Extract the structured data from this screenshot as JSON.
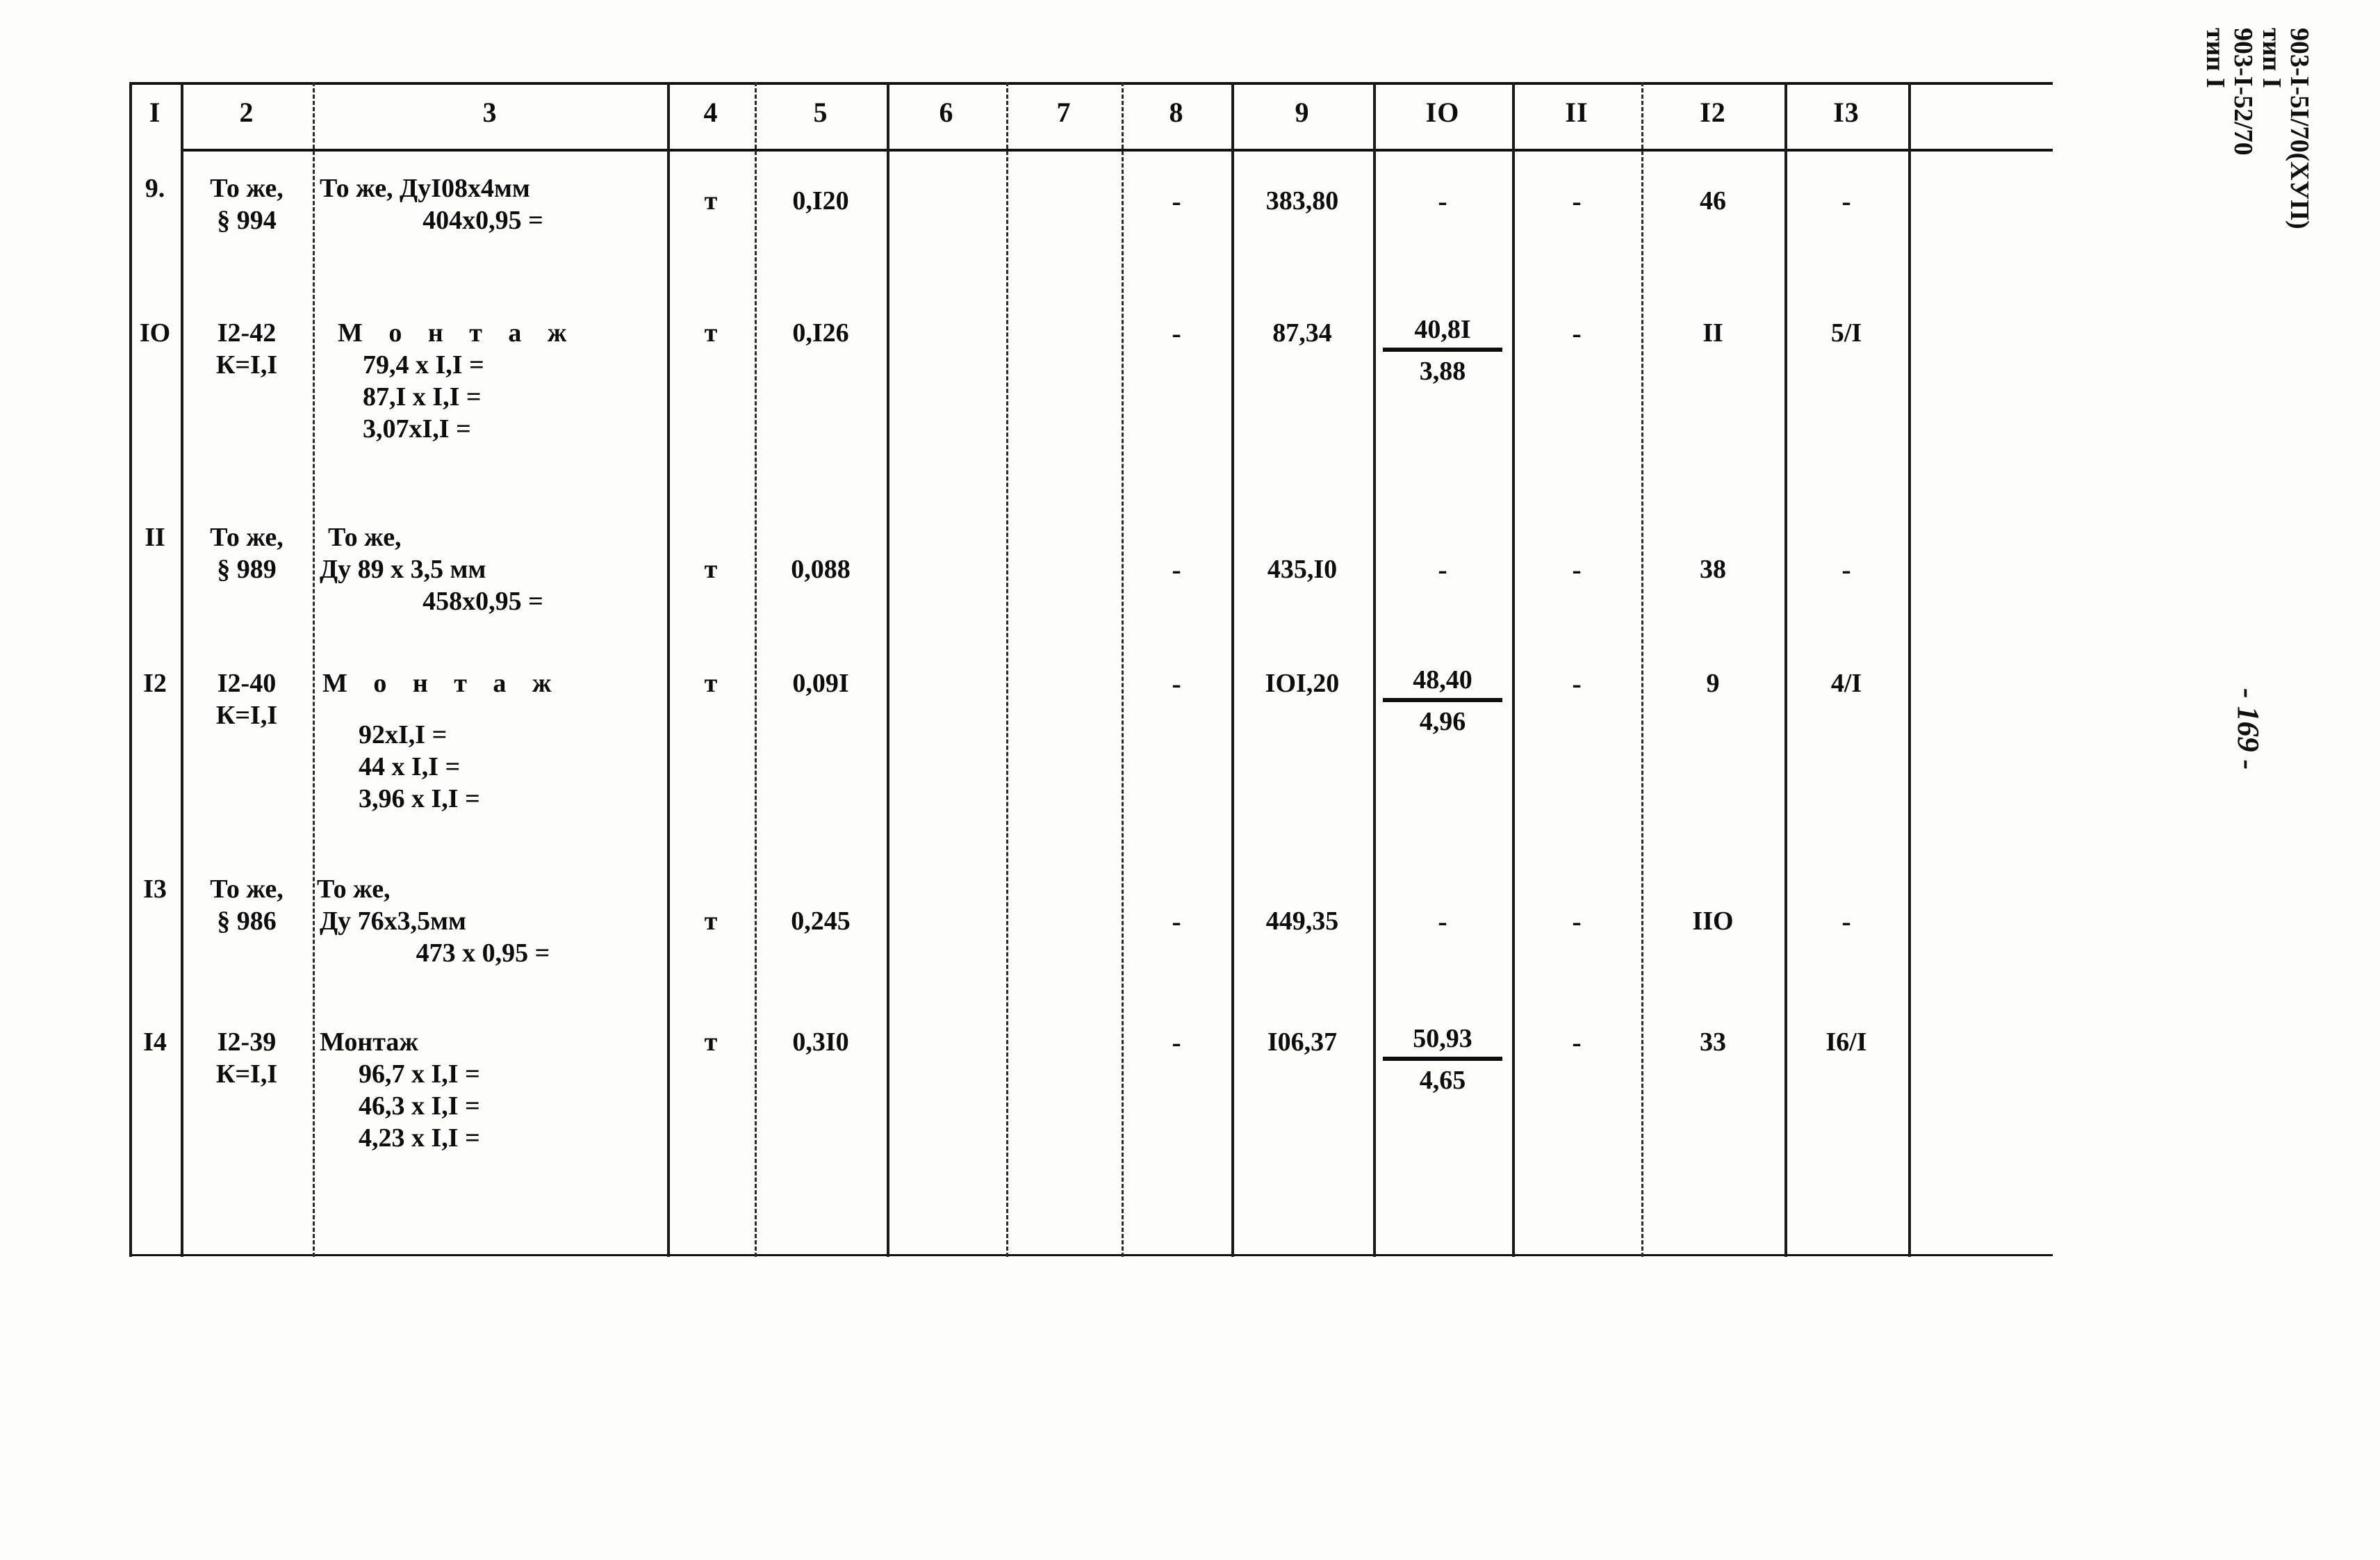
{
  "document": {
    "margin_codes": [
      "903-I-5I/70(ХУП)",
      "тип I",
      "903-I-52/70",
      "тип I"
    ],
    "page_number": "- 169 -"
  },
  "table": {
    "column_headers": [
      "I",
      "2",
      "3",
      "4",
      "5",
      "6",
      "7",
      "8",
      "9",
      "IO",
      "II",
      "I2",
      "I3"
    ],
    "rows": [
      {
        "c1": "9.",
        "c2": [
          "То же,",
          "§ 994"
        ],
        "c3": [
          "То же, ДуI08х4мм",
          "404х0,95 ="
        ],
        "c4": "т",
        "c5": "0,I20",
        "c6": "",
        "c7": "",
        "c8": "-",
        "c9": "383,80",
        "c10": "-",
        "c10_num": "",
        "c10_den": "",
        "c11": "-",
        "c12": "46",
        "c13": "-"
      },
      {
        "c1": "IO",
        "c2": [
          "I2-42",
          "К=I,I"
        ],
        "c3": [
          "М о н т а ж",
          "79,4 х I,I =",
          "87,I х I,I =",
          "3,07хI,I ="
        ],
        "c4": "т",
        "c5": "0,I26",
        "c6": "",
        "c7": "",
        "c8": "-",
        "c9": "87,34",
        "c10": "",
        "c10_num": "40,8I",
        "c10_den": "3,88",
        "c11": "-",
        "c12": "II",
        "c13": "5/I"
      },
      {
        "c1": "II",
        "c2": [
          "То же,",
          "§ 989"
        ],
        "c3": [
          "То же,",
          "Ду 89 х 3,5 мм",
          "458х0,95 ="
        ],
        "c4": "т",
        "c5": "0,088",
        "c6": "",
        "c7": "",
        "c8": "-",
        "c9": "435,I0",
        "c10": "-",
        "c10_num": "",
        "c10_den": "",
        "c11": "-",
        "c12": "38",
        "c13": "-"
      },
      {
        "c1": "I2",
        "c2": [
          "I2-40",
          "К=I,I"
        ],
        "c3": [
          "М о н т а ж",
          "92хI,I =",
          "44 х I,I =",
          "3,96 х I,I ="
        ],
        "c4": "т",
        "c5": "0,09I",
        "c6": "",
        "c7": "",
        "c8": "-",
        "c9": "IOI,20",
        "c10": "",
        "c10_num": "48,40",
        "c10_den": "4,96",
        "c11": "-",
        "c12": "9",
        "c13": "4/I"
      },
      {
        "c1": "I3",
        "c2": [
          "То же,",
          "§ 986"
        ],
        "c3": [
          "То же,",
          "Ду 76х3,5мм",
          "473 х 0,95 ="
        ],
        "c4": "т",
        "c5": "0,245",
        "c6": "",
        "c7": "",
        "c8": "-",
        "c9": "449,35",
        "c10": "-",
        "c10_num": "",
        "c10_den": "",
        "c11": "-",
        "c12": "IIO",
        "c13": "-"
      },
      {
        "c1": "I4",
        "c2": [
          "I2-39",
          "К=I,I"
        ],
        "c3": [
          "Монтаж",
          "96,7 х I,I =",
          "46,3 х I,I =",
          "4,23 х I,I ="
        ],
        "c4": "т",
        "c5": "0,3I0",
        "c6": "",
        "c7": "",
        "c8": "-",
        "c9": "I06,37",
        "c10": "",
        "c10_num": "50,93",
        "c10_den": "4,65",
        "c11": "-",
        "c12": "33",
        "c13": "I6/I"
      }
    ]
  }
}
